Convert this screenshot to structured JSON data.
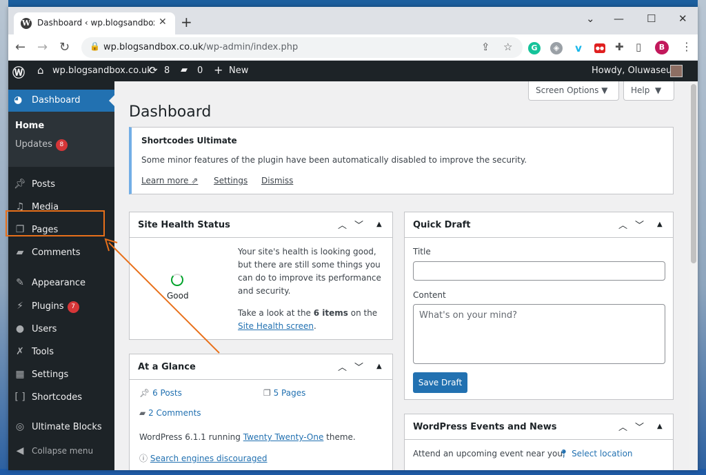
{
  "browser": {
    "tab_title": "Dashboard ‹ wp.blogsandbox.co.uk — WordPress",
    "favicon": "W",
    "url_host": "wp.blogsandbox.co.uk",
    "url_path": "/wp-admin/index.php",
    "profile_initial": "B"
  },
  "adminbar": {
    "site_name": "wp.blogsandbox.co.uk",
    "updates_count": "8",
    "comments_count": "0",
    "new_label": "New",
    "greeting": "Howdy, Oluwaseun"
  },
  "sidebar": {
    "dashboard": "Dashboard",
    "home": "Home",
    "updates": "Updates",
    "updates_badge": "8",
    "items": [
      {
        "label": "Posts",
        "icon": "pin-icon"
      },
      {
        "label": "Media",
        "icon": "media-icon"
      },
      {
        "label": "Pages",
        "icon": "pages-icon"
      },
      {
        "label": "Comments",
        "icon": "comment-icon"
      },
      {
        "label": "Appearance",
        "icon": "brush-icon"
      },
      {
        "label": "Plugins",
        "icon": "plug-icon",
        "badge": "7"
      },
      {
        "label": "Users",
        "icon": "user-icon"
      },
      {
        "label": "Tools",
        "icon": "wrench-icon"
      },
      {
        "label": "Settings",
        "icon": "settings-icon"
      },
      {
        "label": "Shortcodes",
        "icon": "brackets-icon"
      },
      {
        "label": "Ultimate Blocks",
        "icon": "blocks-icon"
      },
      {
        "label": "Collapse menu",
        "icon": "collapse-icon"
      }
    ]
  },
  "main": {
    "screen_options": "Screen Options",
    "help": "Help",
    "title": "Dashboard",
    "notice": {
      "title": "Shortcodes Ultimate",
      "text": "Some minor features of the plugin have been automatically disabled to improve the security.",
      "learn_more": "Learn more",
      "settings": "Settings",
      "dismiss": "Dismiss"
    },
    "site_health": {
      "title": "Site Health Status",
      "status": "Good",
      "text": "Your site's health is looking good, but there are still some things you can do to improve its performance and security.",
      "take_look_pre": "Take a look at the ",
      "items": "6 items",
      "on_the": " on the ",
      "link": "Site Health screen",
      "end": "."
    },
    "glance": {
      "title": "At a Glance",
      "posts": "6 Posts",
      "pages": "5 Pages",
      "comments": "2 Comments",
      "wp_pre": "WordPress 6.1.1 running ",
      "theme": "Twenty Twenty-One",
      "wp_post": " theme.",
      "search": "Search engines discouraged"
    },
    "quick_draft": {
      "title": "Quick Draft",
      "title_label": "Title",
      "content_label": "Content",
      "content_placeholder": "What's on your mind?",
      "save": "Save Draft"
    },
    "events": {
      "title": "WordPress Events and News",
      "text": "Attend an upcoming event near you.",
      "select": "Select location"
    }
  },
  "colors": {
    "wp_blue": "#2271b1",
    "adminbar": "#1d2327",
    "highlight_box": "#e8701a",
    "badge": "#d63638"
  }
}
